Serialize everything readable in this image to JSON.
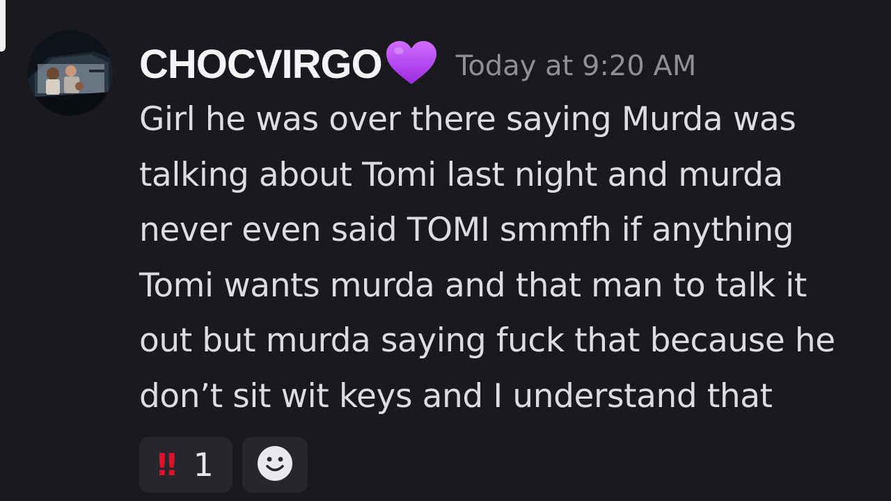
{
  "message": {
    "author": {
      "username": "CHOCVIRGO",
      "badge_icon": "purple-heart-icon",
      "name_color": "#f3f4f6"
    },
    "timestamp": "Today at 9:20 AM",
    "content": "Girl he was over there saying Murda was\ntalking about Tomi last night and murda\nnever even said TOMI smmfh if anything\nTomi wants murda and that man to talk it\nout but murda saying fuck that because he\ndon’t sit wit keys and I understand that",
    "reactions": [
      {
        "emoji": "‼",
        "emoji_name": "double-exclamation-icon",
        "count": "1",
        "color": "#e0102a"
      }
    ],
    "add_reaction_icon": "smiley-icon"
  },
  "colors": {
    "background": "#1a1a1e",
    "reaction_bg": "#26272c",
    "timestamp": "#8e9097",
    "heart": "#b43cf0"
  }
}
